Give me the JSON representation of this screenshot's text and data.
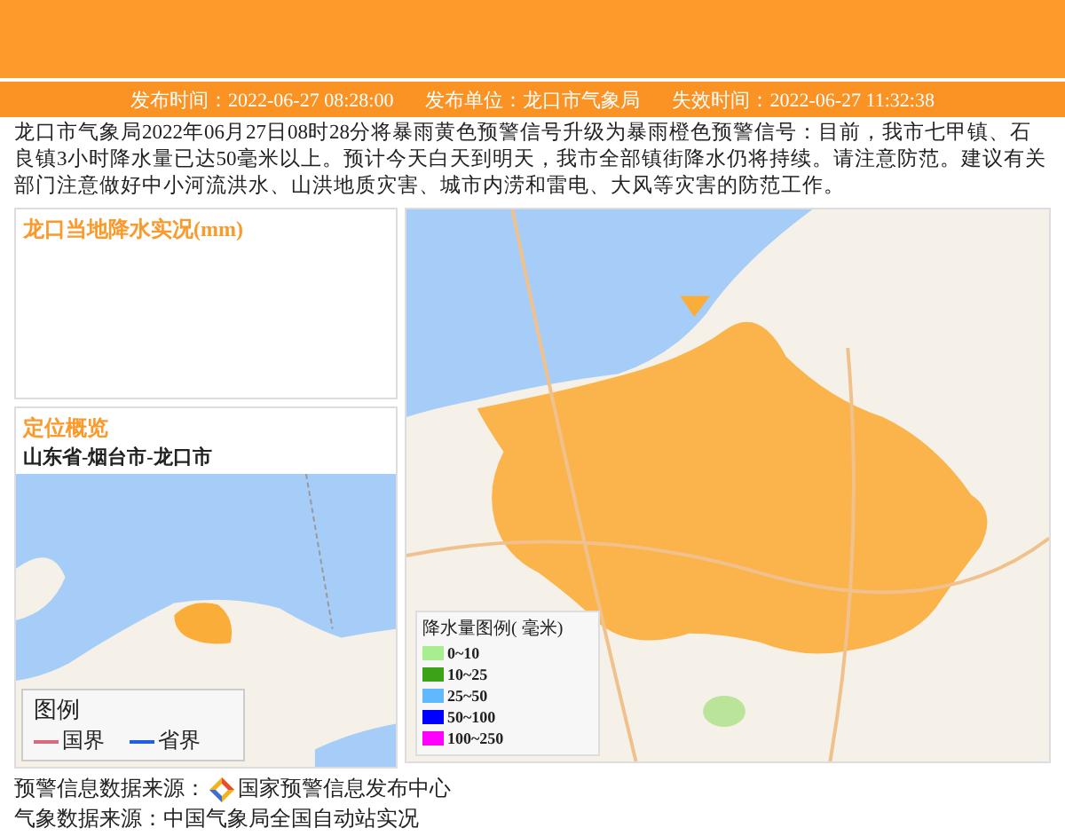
{
  "header": {
    "publish_time": "发布时间：2022-06-27 08:28:00",
    "publisher": "发布单位：龙口市气象局",
    "expire_time": "失效时间：2022-06-27 11:32:38"
  },
  "description": "龙口市气象局2022年06月27日08时28分将暴雨黄色预警信号升级为暴雨橙色预警信号：目前，我市七甲镇、石良镇3小时降水量已达50毫米以上。预计今天白天到明天，我市全部镇街降水仍将持续。请注意防范。建议有关部门注意做好中小河流洪水、山洪地质灾害、城市内涝和雷电、大风等灾害的防范工作。",
  "rainfall_panel": {
    "title": "龙口当地降水实况(mm)"
  },
  "location_panel": {
    "title": "定位概览",
    "path": "山东省-烟台市-龙口市",
    "legend": {
      "title": "图例",
      "items": [
        {
          "label": "国界",
          "color": "#d9687a"
        },
        {
          "label": "省界",
          "color": "#1f5fe0"
        }
      ]
    }
  },
  "rain_legend": {
    "title": "降水量图例( 毫米)",
    "items": [
      {
        "label": "0~10",
        "color": "#a8ee90"
      },
      {
        "label": "10~25",
        "color": "#3ca318"
      },
      {
        "label": "25~50",
        "color": "#62b8ff"
      },
      {
        "label": "50~100",
        "color": "#0000fe"
      },
      {
        "label": "100~250",
        "color": "#fd00fe"
      }
    ]
  },
  "footer": {
    "source_label": "预警信息数据来源：",
    "source": "国家预警信息发布中心",
    "weather_source": "气象数据来源：中国气象局全国自动站实况"
  }
}
